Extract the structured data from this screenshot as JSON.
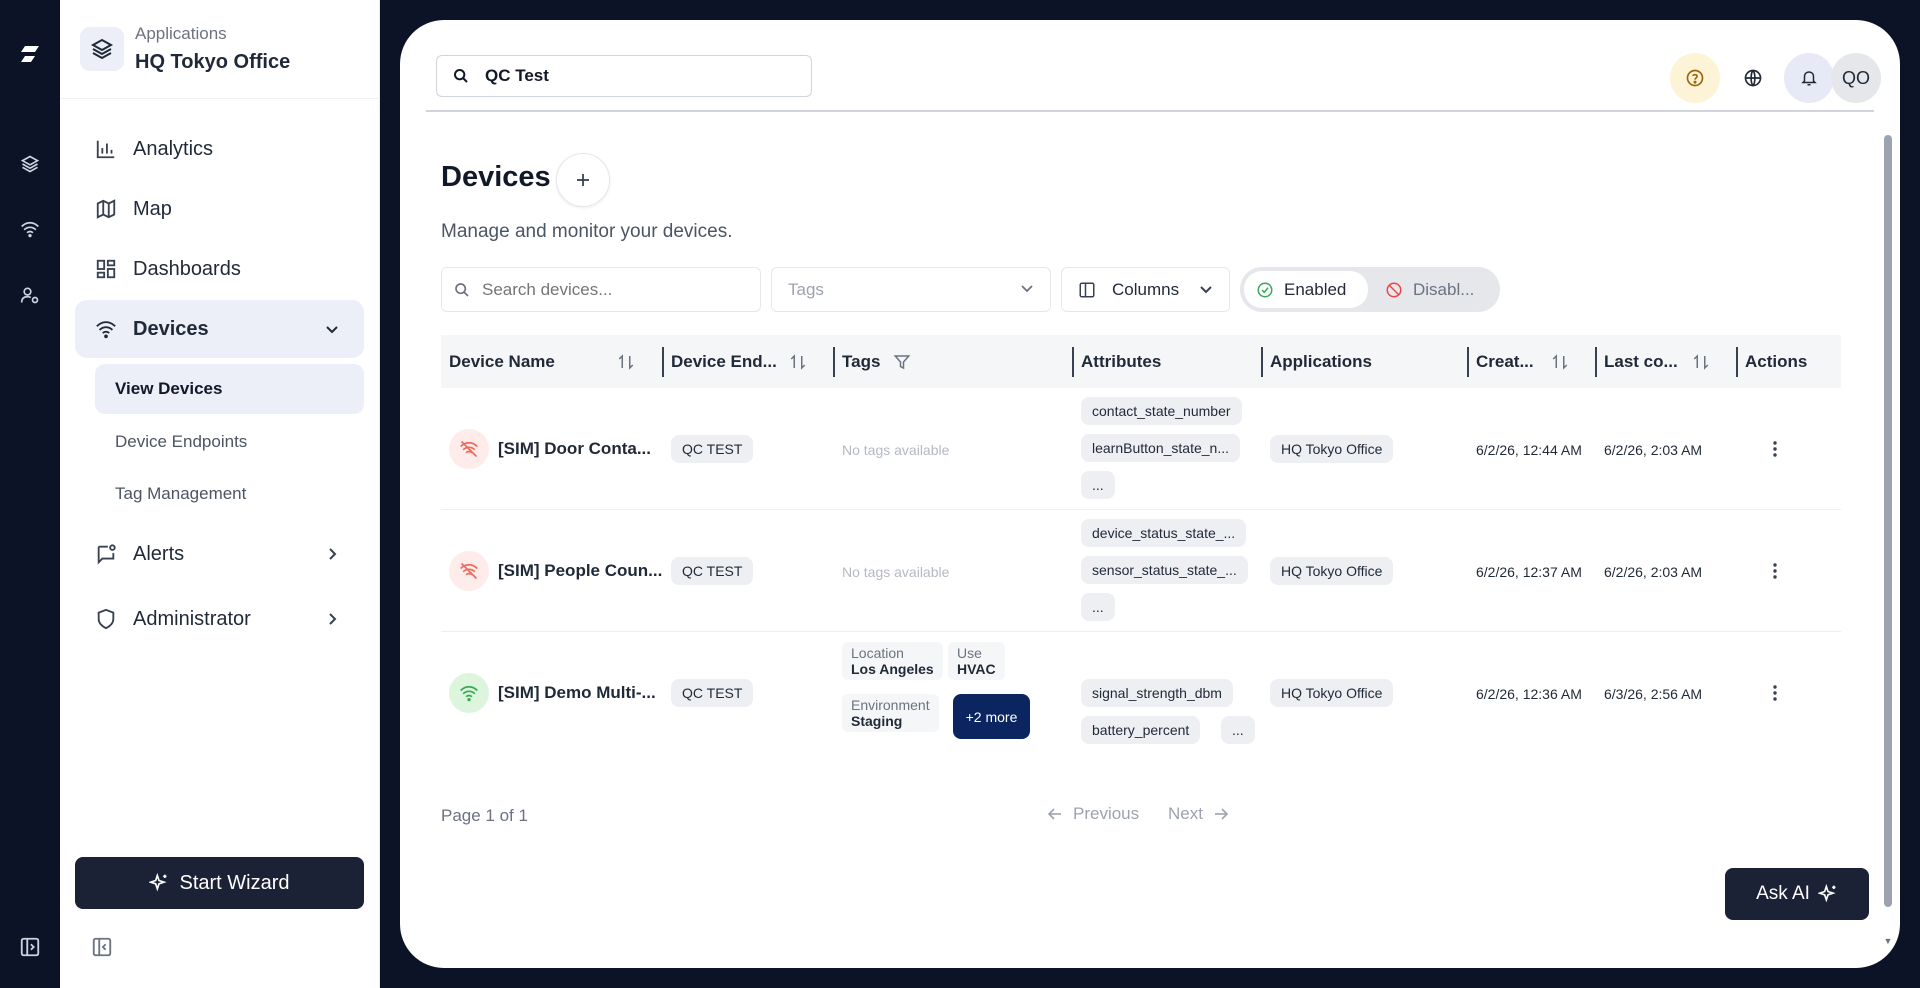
{
  "sidebar": {
    "app_label": "Applications",
    "app_name": "HQ Tokyo Office",
    "nav": {
      "analytics": "Analytics",
      "map": "Map",
      "dashboards": "Dashboards",
      "devices": "Devices",
      "alerts": "Alerts",
      "administrator": "Administrator"
    },
    "sub": {
      "view_devices": "View Devices",
      "device_endpoints": "Device Endpoints",
      "tag_management": "Tag Management"
    },
    "wizard": "Start Wizard"
  },
  "topbar": {
    "search_value": "QC Test",
    "avatar": "QO"
  },
  "page": {
    "title": "Devices",
    "subtitle": "Manage and monitor your devices."
  },
  "toolbar": {
    "search_placeholder": "Search devices...",
    "tags_placeholder": "Tags",
    "columns": "Columns",
    "enabled": "Enabled",
    "disabled": "Disabl..."
  },
  "table": {
    "headers": {
      "device_name": "Device Name",
      "device_endpoint": "Device End...",
      "tags": "Tags",
      "attributes": "Attributes",
      "applications": "Applications",
      "created": "Creat...",
      "last_connected": "Last co...",
      "actions": "Actions"
    },
    "rows": [
      {
        "status": "offline",
        "name": "[SIM] Door Conta...",
        "endpoint": "QC TEST",
        "tags_empty": "No tags available",
        "attributes": [
          "contact_state_number",
          "learnButton_state_n...",
          "..."
        ],
        "application": "HQ Tokyo Office",
        "created": "6/2/26, 12:44 AM",
        "last_connected": "6/2/26, 2:03 AM"
      },
      {
        "status": "offline",
        "name": "[SIM] People Coun...",
        "endpoint": "QC TEST",
        "tags_empty": "No tags available",
        "attributes": [
          "device_status_state_...",
          "sensor_status_state_...",
          "..."
        ],
        "application": "HQ Tokyo Office",
        "created": "6/2/26, 12:37 AM",
        "last_connected": "6/2/26, 2:03 AM"
      },
      {
        "status": "online",
        "name": "[SIM] Demo Multi-...",
        "endpoint": "QC TEST",
        "tags": [
          {
            "key": "Location",
            "value": "Los Angeles"
          },
          {
            "key": "Use",
            "value": "HVAC"
          },
          {
            "key": "Environment",
            "value": "Staging"
          }
        ],
        "tags_more": "+2 more",
        "attributes": [
          "signal_strength_dbm",
          "battery_percent",
          "..."
        ],
        "application": "HQ Tokyo Office",
        "created": "6/2/26, 12:36 AM",
        "last_connected": "6/3/26, 2:56 AM"
      }
    ]
  },
  "pagination": {
    "info": "Page 1 of 1",
    "previous": "Previous",
    "next": "Next"
  },
  "ask_ai": "Ask AI",
  "colors": {
    "rail_bg": "#0d1326",
    "active_bg": "#eceef8",
    "primary_dark": "#1b2236",
    "more_badge": "#0b2560",
    "online": "#3aa857",
    "offline": "#ef6a5c"
  }
}
